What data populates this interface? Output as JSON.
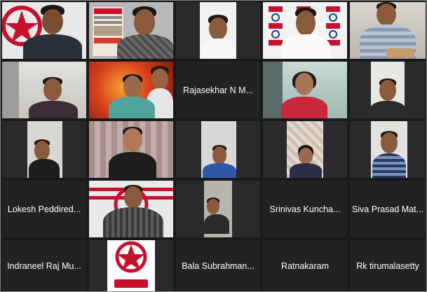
{
  "participants": [
    {
      "name": "",
      "type": "video"
    },
    {
      "name": "",
      "type": "video"
    },
    {
      "name": "",
      "type": "video"
    },
    {
      "name": "",
      "type": "video",
      "active": true
    },
    {
      "name": "",
      "type": "video"
    },
    {
      "name": "",
      "type": "video"
    },
    {
      "name": "",
      "type": "video"
    },
    {
      "name": "Rajasekhar N  M...",
      "type": "name"
    },
    {
      "name": "",
      "type": "video"
    },
    {
      "name": "",
      "type": "video"
    },
    {
      "name": "",
      "type": "video"
    },
    {
      "name": "",
      "type": "video"
    },
    {
      "name": "",
      "type": "video"
    },
    {
      "name": "",
      "type": "video"
    },
    {
      "name": "",
      "type": "video"
    },
    {
      "name": "Lokesh Peddired...",
      "type": "name"
    },
    {
      "name": "",
      "type": "video"
    },
    {
      "name": "",
      "type": "video"
    },
    {
      "name": "Srinivas Kuncha...",
      "type": "name"
    },
    {
      "name": "Siva Prasad Mat...",
      "type": "name"
    },
    {
      "name": "Indraneel Raj Mu...",
      "type": "name"
    },
    {
      "name": "",
      "type": "video"
    },
    {
      "name": "Bala Subrahman...",
      "type": "name"
    },
    {
      "name": "Ratnakaram",
      "type": "name"
    },
    {
      "name": "Rk tirumalasetty",
      "type": "name"
    }
  ],
  "colors": {
    "active_border": "#5bc236",
    "tile_bg": "#222222",
    "brand_red": "#c8102e"
  }
}
